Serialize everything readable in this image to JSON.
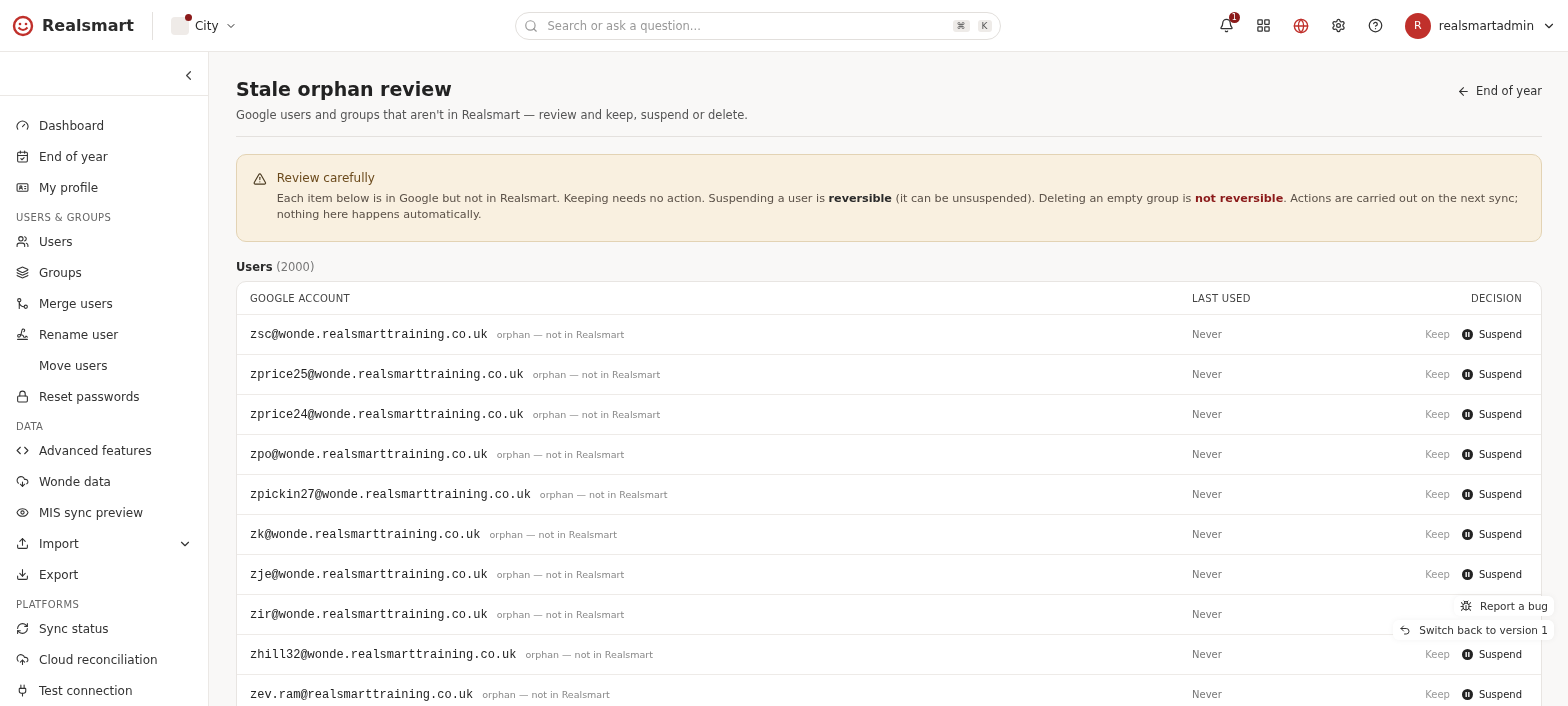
{
  "header": {
    "brand": "Realsmart",
    "school": {
      "name": "City"
    },
    "search": {
      "placeholder": "Search or ask a question...",
      "keys": [
        "⌘",
        "K"
      ]
    },
    "notifications": {
      "badge": "1"
    },
    "user": {
      "initial": "R",
      "name": "realsmartadmin"
    }
  },
  "sidebar": {
    "sections": [
      {
        "items": [
          {
            "label": "Dashboard",
            "kind": "link"
          },
          {
            "label": "End of year",
            "kind": "link"
          },
          {
            "label": "My profile",
            "kind": "link"
          }
        ]
      },
      {
        "heading": "USERS & GROUPS",
        "items": [
          {
            "label": "Users",
            "kind": "link"
          },
          {
            "label": "Groups",
            "kind": "link"
          },
          {
            "label": "Merge users",
            "kind": "link"
          },
          {
            "label": "Rename user",
            "kind": "link"
          },
          {
            "label": "Move users",
            "kind": "link"
          },
          {
            "label": "Reset passwords",
            "kind": "link"
          }
        ]
      },
      {
        "heading": "DATA",
        "items": [
          {
            "label": "Advanced features",
            "kind": "link"
          },
          {
            "label": "Wonde data",
            "kind": "link"
          },
          {
            "label": "MIS sync preview",
            "kind": "link"
          },
          {
            "label": "Import",
            "kind": "group"
          },
          {
            "label": "Export",
            "kind": "link"
          }
        ]
      },
      {
        "heading": "PLATFORMS",
        "items": [
          {
            "label": "Sync status",
            "kind": "link"
          },
          {
            "label": "Cloud reconciliation",
            "kind": "link"
          },
          {
            "label": "Test connection",
            "kind": "link"
          }
        ]
      }
    ]
  },
  "page": {
    "title": "Stale orphan review",
    "subtitle": "Google users and groups that aren't in Realsmart — review and keep, suspend or delete.",
    "back_link": "End of year"
  },
  "alert": {
    "title": "Review carefully",
    "body": "Each item below is in Google but not in Realsmart. Keeping needs no action. Suspending a user is **reversible** (it can be unsuspended). Deleting an empty group is **not reversible**. Actions are carried out on the next sync; nothing here happens automatically."
  },
  "users": {
    "title": "Users",
    "count": "(2000)",
    "columns": [
      "GOOGLE ACCOUNT",
      "LAST USED",
      "DECISION"
    ],
    "rows": [
      {
        "account": "zsc@wonde.realsmarttraining.co.uk",
        "note": "orphan — not in Realsmart",
        "last_used": "Never",
        "decisions": [
          {
            "label": "Keep",
            "selected": false
          },
          {
            "label": "Suspend",
            "selected": true
          }
        ]
      },
      {
        "account": "zprice25@wonde.realsmarttraining.co.uk",
        "note": "orphan — not in Realsmart",
        "last_used": "Never",
        "decisions": [
          {
            "label": "Keep",
            "selected": false
          },
          {
            "label": "Suspend",
            "selected": true
          }
        ]
      },
      {
        "account": "zprice24@wonde.realsmarttraining.co.uk",
        "note": "orphan — not in Realsmart",
        "last_used": "Never",
        "decisions": [
          {
            "label": "Keep",
            "selected": false
          },
          {
            "label": "Suspend",
            "selected": true
          }
        ]
      },
      {
        "account": "zpo@wonde.realsmarttraining.co.uk",
        "note": "orphan — not in Realsmart",
        "last_used": "Never",
        "decisions": [
          {
            "label": "Keep",
            "selected": false
          },
          {
            "label": "Suspend",
            "selected": true
          }
        ]
      },
      {
        "account": "zpickin27@wonde.realsmarttraining.co.uk",
        "note": "orphan — not in Realsmart",
        "last_used": "Never",
        "decisions": [
          {
            "label": "Keep",
            "selected": false
          },
          {
            "label": "Suspend",
            "selected": true
          }
        ]
      },
      {
        "account": "zk@wonde.realsmarttraining.co.uk",
        "note": "orphan — not in Realsmart",
        "last_used": "Never",
        "decisions": [
          {
            "label": "Keep",
            "selected": false
          },
          {
            "label": "Suspend",
            "selected": true
          }
        ]
      },
      {
        "account": "zje@wonde.realsmarttraining.co.uk",
        "note": "orphan — not in Realsmart",
        "last_used": "Never",
        "decisions": [
          {
            "label": "Keep",
            "selected": false
          },
          {
            "label": "Suspend",
            "selected": true
          }
        ]
      },
      {
        "account": "zir@wonde.realsmarttraining.co.uk",
        "note": "orphan — not in Realsmart",
        "last_used": "Never"
      },
      {
        "account": "zhill32@wonde.realsmarttraining.co.uk",
        "note": "orphan — not in Realsmart",
        "last_used": "Never",
        "decisions": [
          {
            "label": "Keep",
            "selected": false
          },
          {
            "label": "Suspend",
            "selected": true
          }
        ]
      },
      {
        "account": "zev.ram@realsmarttraining.co.uk",
        "note": "orphan — not in Realsmart",
        "last_used": "Never",
        "decisions": [
          {
            "label": "Keep",
            "selected": false
          },
          {
            "label": "Suspend",
            "selected": true
          }
        ]
      }
    ]
  },
  "floating_actions": [
    {
      "label": "Report a bug"
    },
    {
      "label": "Switch back to version 1"
    }
  ]
}
